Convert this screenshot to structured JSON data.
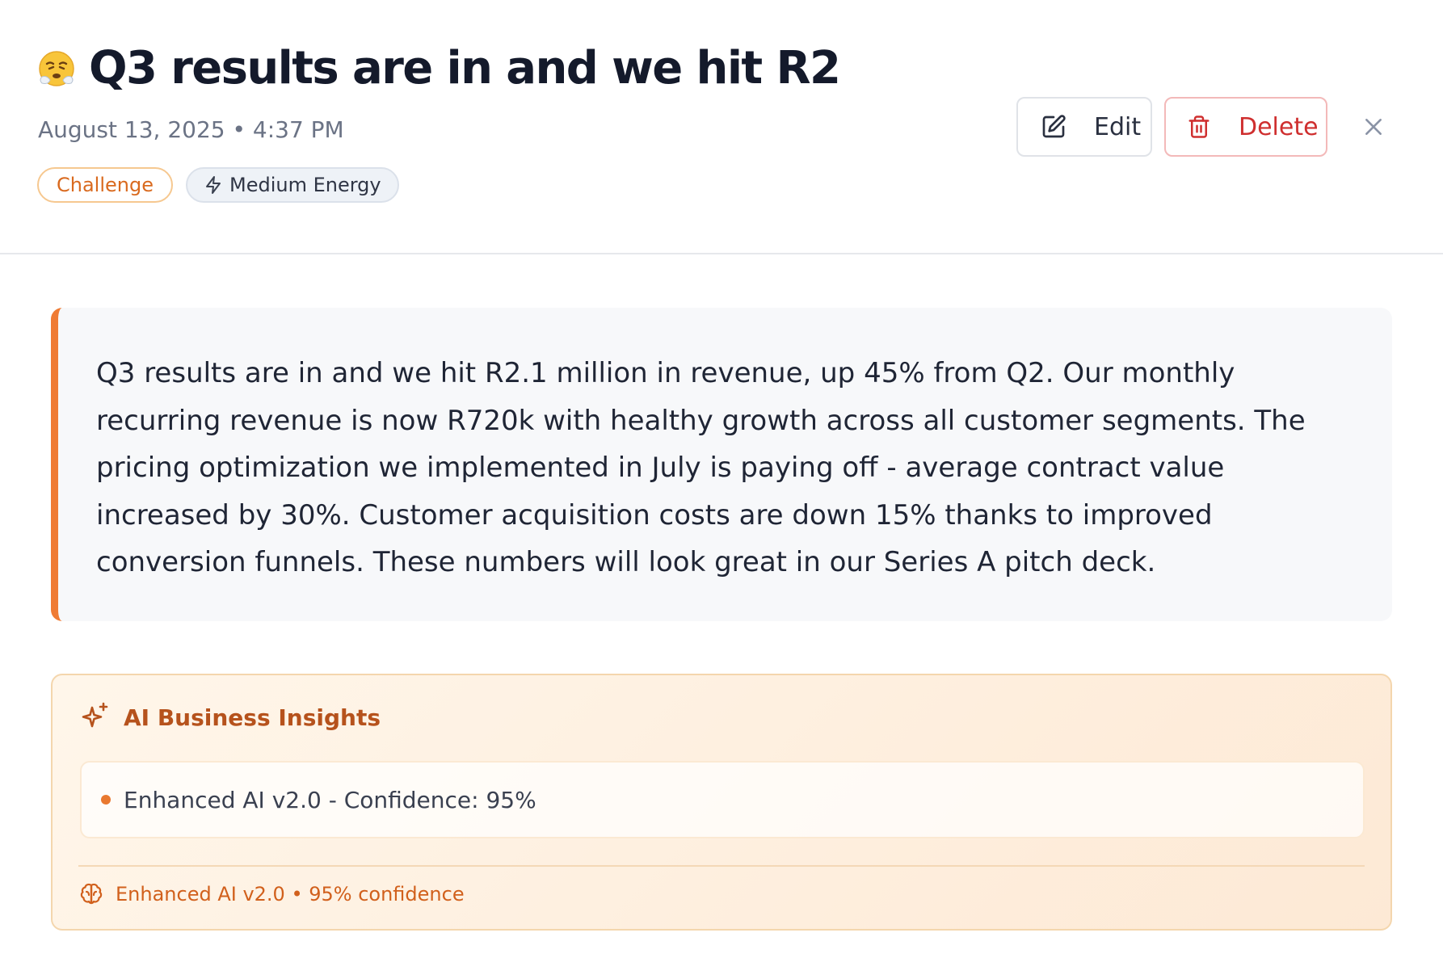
{
  "entry": {
    "title": "Q3 results are in and we hit R2",
    "emoji_icon": "steam-face-emoji",
    "datetime": "August 13, 2025 • 4:37 PM",
    "tags": {
      "category": "Challenge",
      "energy": "Medium Energy"
    },
    "body": "Q3 results are in and we hit R2.1 million in revenue, up 45% from Q2. Our monthly recurring revenue is now R720k with healthy growth across all customer segments. The pricing optimization we implemented in July is paying off - average contract value increased by 30%. Customer acquisition costs are down 15% thanks to improved conversion funnels. These numbers will look great in our Series A pitch deck."
  },
  "toolbar": {
    "edit_label": "Edit",
    "delete_label": "Delete"
  },
  "insights": {
    "title": "AI Business Insights",
    "items": [
      "Enhanced AI v2.0 - Confidence: 95%"
    ],
    "footer": "Enhanced AI v2.0 • 95% confidence"
  },
  "colors": {
    "accent_orange": "#ef7b34",
    "delete_red": "#cf2f2f",
    "insight_title": "#b6521c",
    "title_dark": "#141a2b"
  }
}
